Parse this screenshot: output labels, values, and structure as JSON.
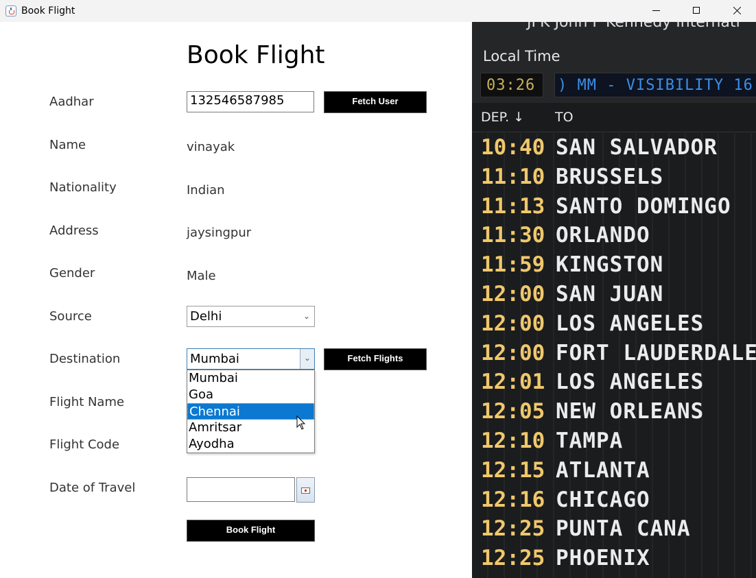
{
  "window": {
    "title": "Book Flight"
  },
  "form": {
    "heading": "Book Flight",
    "labels": {
      "aadhar": "Aadhar",
      "name": "Name",
      "nationality": "Nationality",
      "address": "Address",
      "gender": "Gender",
      "source": "Source",
      "destination": "Destination",
      "flight_name": "Flight Name",
      "flight_code": "Flight Code",
      "date_of_travel": "Date of Travel"
    },
    "aadhar_value": "132546587985",
    "fetch_user_label": "Fetch User",
    "name_value": "vinayak",
    "nationality_value": "Indian",
    "address_value": "jaysingpur",
    "gender_value": "Male",
    "source_value": "Delhi",
    "destination_value": "Mumbai",
    "fetch_flights_label": "Fetch Flights",
    "destination_options": [
      "Mumbai",
      "Goa",
      "Chennai",
      "Amritsar",
      "Ayodha"
    ],
    "highlighted_option": "Chennai",
    "date_value": "",
    "book_flight_label": "Book Flight"
  },
  "board": {
    "airport_partial": "JFK John F Kennedy Internati",
    "local_time_label": "Local Time",
    "local_time": "03:26",
    "ticker_text": ") MM - VISIBILITY 16",
    "dep_header": "DEP. ↓",
    "to_header": "TO",
    "departures": [
      {
        "time": "10:40",
        "dest": "SAN SALVADOR"
      },
      {
        "time": "11:10",
        "dest": "BRUSSELS"
      },
      {
        "time": "11:13",
        "dest": "SANTO DOMINGO"
      },
      {
        "time": "11:30",
        "dest": "ORLANDO"
      },
      {
        "time": "11:59",
        "dest": "KINGSTON"
      },
      {
        "time": "12:00",
        "dest": "SAN JUAN"
      },
      {
        "time": "12:00",
        "dest": "LOS ANGELES"
      },
      {
        "time": "12:00",
        "dest": "FORT LAUDERDALE"
      },
      {
        "time": "12:01",
        "dest": "LOS ANGELES"
      },
      {
        "time": "12:05",
        "dest": "NEW ORLEANS"
      },
      {
        "time": "12:10",
        "dest": "TAMPA"
      },
      {
        "time": "12:15",
        "dest": "ATLANTA"
      },
      {
        "time": "12:16",
        "dest": "CHICAGO"
      },
      {
        "time": "12:25",
        "dest": "PUNTA CANA"
      },
      {
        "time": "12:25",
        "dest": "PHOENIX"
      }
    ]
  },
  "colors": {
    "button_bg": "#000000",
    "selection": "#0b78d1",
    "board_time": "#f0c86b",
    "ticker": "#3b8ee8"
  }
}
